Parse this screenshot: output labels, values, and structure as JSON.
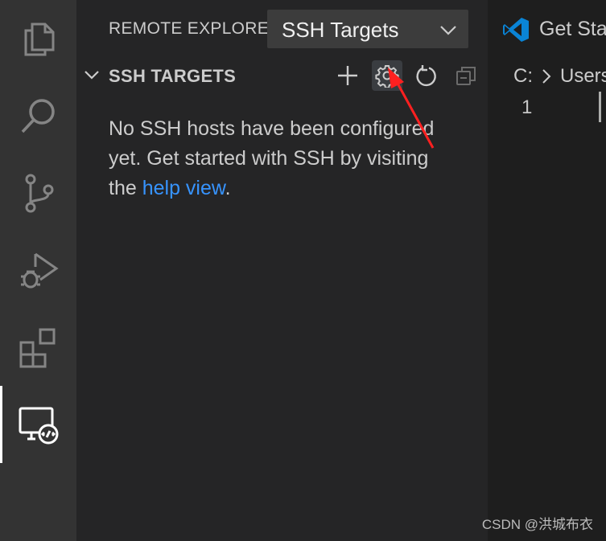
{
  "activity_bar": {
    "items": [
      {
        "name": "explorer",
        "icon": "files-icon"
      },
      {
        "name": "search",
        "icon": "search-icon"
      },
      {
        "name": "source-control",
        "icon": "source-control-icon"
      },
      {
        "name": "run-and-debug",
        "icon": "run-debug-icon"
      },
      {
        "name": "extensions",
        "icon": "extensions-icon"
      },
      {
        "name": "remote-explorer",
        "icon": "remote-explorer-icon",
        "active": true
      }
    ]
  },
  "sidebar": {
    "title": "REMOTE EXPLORER",
    "dropdown": {
      "value": "SSH Targets"
    },
    "section": {
      "title": "SSH TARGETS",
      "actions": [
        {
          "name": "add-new",
          "icon": "plus-icon"
        },
        {
          "name": "configure",
          "icon": "gear-icon",
          "highlighted": true
        },
        {
          "name": "refresh",
          "icon": "refresh-icon"
        },
        {
          "name": "collapse-all",
          "icon": "collapse-all-icon"
        }
      ]
    },
    "message": {
      "part1": "No SSH hosts have been configured yet. Get started with SSH by visiting the ",
      "link": "help view",
      "part2": "."
    }
  },
  "editor": {
    "tab": {
      "label": "Get Sta",
      "icon": "vscode-logo-icon"
    },
    "breadcrumb": {
      "drive": "C:",
      "folder": "Users"
    },
    "line_number": "1"
  },
  "watermark": "CSDN @洪城布衣",
  "colors": {
    "activity_bar": "#333333",
    "sidebar": "#252526",
    "editor": "#1e1e1e",
    "link": "#3794ff",
    "annotation": "#ff2020"
  }
}
